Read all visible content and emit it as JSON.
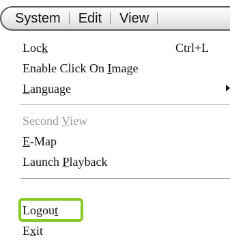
{
  "menubar": {
    "items": [
      "System",
      "Edit",
      "View"
    ]
  },
  "menu": {
    "lock": {
      "pre": "Loc",
      "acc": "k",
      "post": "",
      "shortcut": "Ctrl+L"
    },
    "enable_click": {
      "pre": "Enable Click On ",
      "acc": "I",
      "post": "mage"
    },
    "language": {
      "pre": "",
      "acc": "L",
      "post": "anguage"
    },
    "second_view": {
      "pre": "Second ",
      "acc": "V",
      "post": "iew"
    },
    "emap": {
      "pre": "",
      "acc": "E",
      "post": "-Map"
    },
    "launch_playback": {
      "pre": "Launch ",
      "acc": "P",
      "post": "layback"
    },
    "logout": {
      "pre": "Logou",
      "acc": "t",
      "post": ""
    },
    "exit": {
      "pre": "E",
      "acc": "x",
      "post": "it"
    }
  },
  "colors": {
    "highlight": "#8ac926",
    "disabled_text": "#9a9a9a"
  }
}
